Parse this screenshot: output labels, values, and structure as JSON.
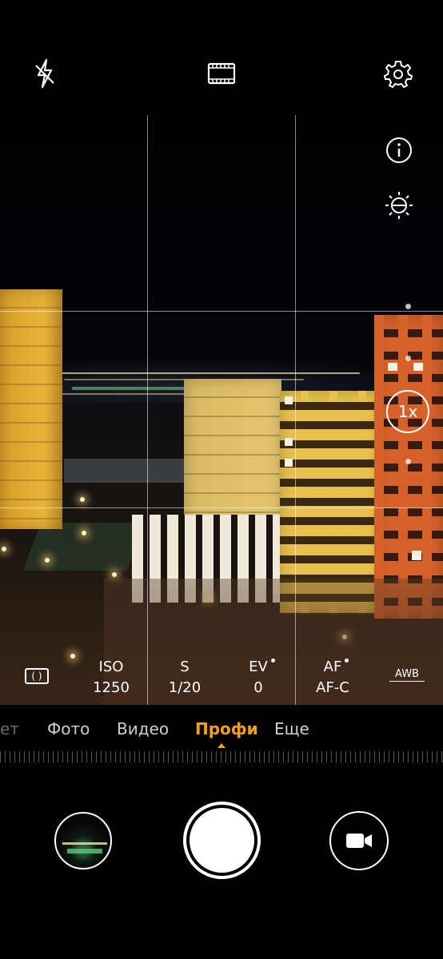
{
  "topbar": {
    "flash_icon": "flash-off-icon",
    "aspect_icon": "film-aspect-icon",
    "settings_icon": "gear-icon"
  },
  "side_controls": {
    "info_icon": "info-icon",
    "brightness_icon": "brightness-icon",
    "zoom_label": "1x"
  },
  "pro_params": [
    {
      "label": "",
      "value": "",
      "icon": "metering-icon"
    },
    {
      "label": "ISO",
      "value": "1250"
    },
    {
      "label": "S",
      "value": "1/20"
    },
    {
      "label": "EV",
      "value": "0"
    },
    {
      "label": "AF",
      "value": "AF-C"
    },
    {
      "label": "AWB",
      "value": ""
    }
  ],
  "modes": [
    "ет",
    "Фото",
    "Видео",
    "Профи",
    "Еще"
  ],
  "active_mode": "Профи",
  "bottom": {
    "gallery_icon": "gallery-thumbnail",
    "shutter_icon": "shutter-button",
    "video_icon": "video-camera-icon"
  },
  "colors": {
    "accent": "#f5a019",
    "building_yellow": "#e8b33a",
    "building_orange": "#d8612a"
  }
}
